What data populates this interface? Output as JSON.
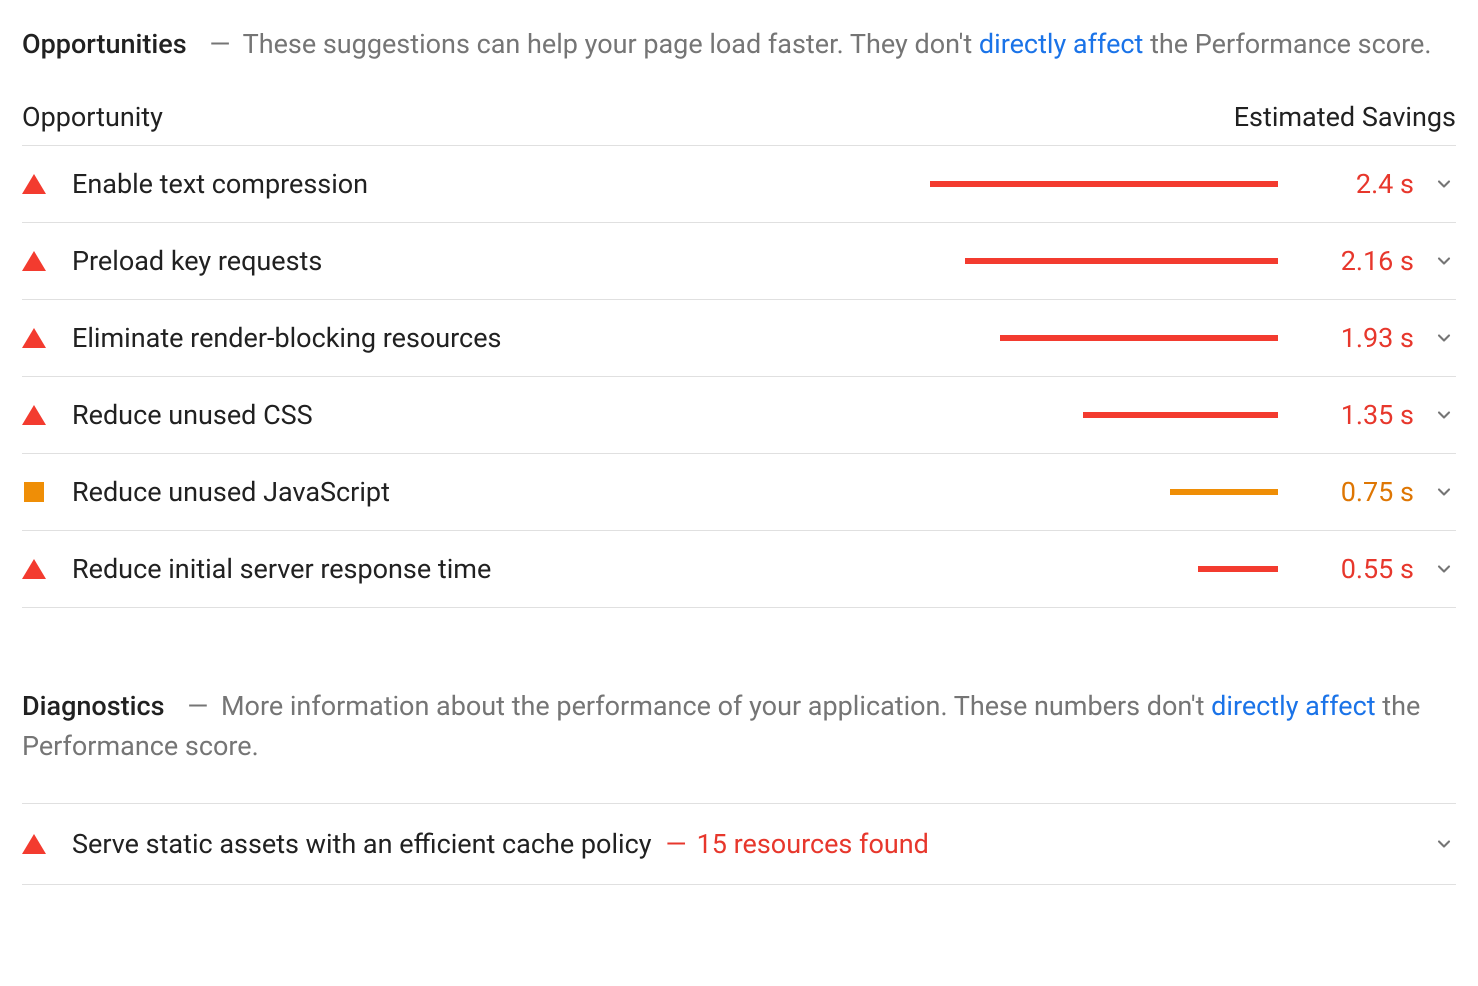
{
  "opportunities": {
    "title": "Opportunities",
    "desc_prefix": "These suggestions can help your page load faster. They don't ",
    "desc_link": "directly affect",
    "desc_suffix": " the Performance score.",
    "col_left": "Opportunity",
    "col_right": "Estimated Savings",
    "items": [
      {
        "severity": "fail",
        "title": "Enable text compression",
        "savings": "2.4 s",
        "bar_pct": 100
      },
      {
        "severity": "fail",
        "title": "Preload key requests",
        "savings": "2.16 s",
        "bar_pct": 90
      },
      {
        "severity": "fail",
        "title": "Eliminate render-blocking resources",
        "savings": "1.93 s",
        "bar_pct": 80
      },
      {
        "severity": "fail",
        "title": "Reduce unused CSS",
        "savings": "1.35 s",
        "bar_pct": 56
      },
      {
        "severity": "average",
        "title": "Reduce unused JavaScript",
        "savings": "0.75 s",
        "bar_pct": 31
      },
      {
        "severity": "fail",
        "title": "Reduce initial server response time",
        "savings": "0.55 s",
        "bar_pct": 23
      }
    ]
  },
  "diagnostics": {
    "title": "Diagnostics",
    "desc_prefix": "More information about the performance of your application. These numbers don't ",
    "desc_link": "directly affect",
    "desc_suffix": " the Performance score.",
    "items": [
      {
        "severity": "fail",
        "title": "Serve static assets with an efficient cache policy",
        "sep": "—",
        "detail": "15 resources found"
      }
    ]
  },
  "colors": {
    "fail": "#f33b2f",
    "average": "#ef8e06",
    "link": "#1a73e8"
  }
}
